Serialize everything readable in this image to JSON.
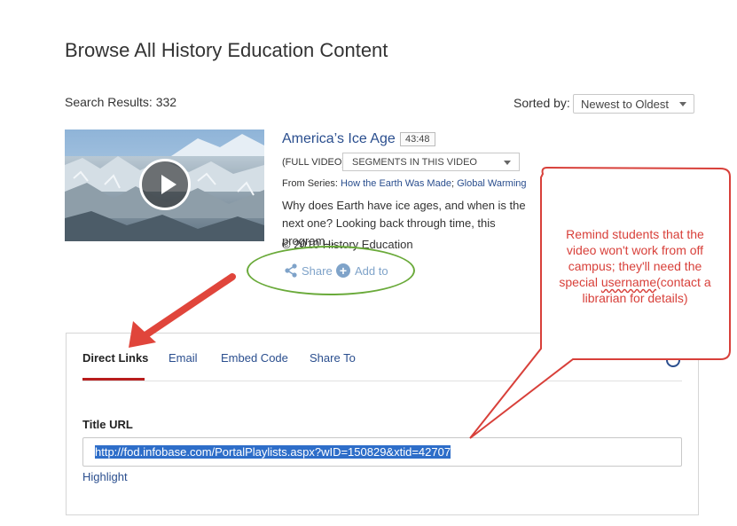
{
  "header": {
    "title": "Browse All History Education Content"
  },
  "results": {
    "count_label": "Search Results: 332",
    "sort_label": "Sorted by:",
    "sort_selected": "Newest to Oldest"
  },
  "video": {
    "title": "America’s Ice Age",
    "duration": "43:48",
    "full_video_label": "(FULL VIDEO)",
    "segments_selected": "SEGMENTS IN THIS VIDEO",
    "series_prefix": "From Series:",
    "series_link_1": "How the Earth Was Made",
    "series_sep": "; ",
    "series_link_2": "Global Warming",
    "description": "Why does Earth have ice ages, and when is the next one? Looking back through time, this program...",
    "copyright": "© 2010 History Education",
    "share_label": "Share",
    "add_label": "Add to"
  },
  "share_panel": {
    "tabs": [
      {
        "label": "Direct Links"
      },
      {
        "label": "Email"
      },
      {
        "label": "Embed Code"
      },
      {
        "label": "Share To"
      }
    ],
    "title_url_label": "Title URL",
    "url_value": "http://fod.infobase.com/PortalPlaylists.aspx?wID=150829&xtid=42707",
    "highlight_label": "Highlight"
  },
  "annotation": {
    "callout_line_1": "Remind students that the video won't work from off campus; they'll need the special",
    "callout_squiggle": "username",
    "callout_line_2": "(contact a librarian for details)",
    "arrow_color": "#e0453b",
    "ellipse_color": "#6aaa3a"
  },
  "colors": {
    "link": "#2a4e8e",
    "active_tab_underline": "#b81d1d",
    "selection": "#2e6ec9"
  }
}
